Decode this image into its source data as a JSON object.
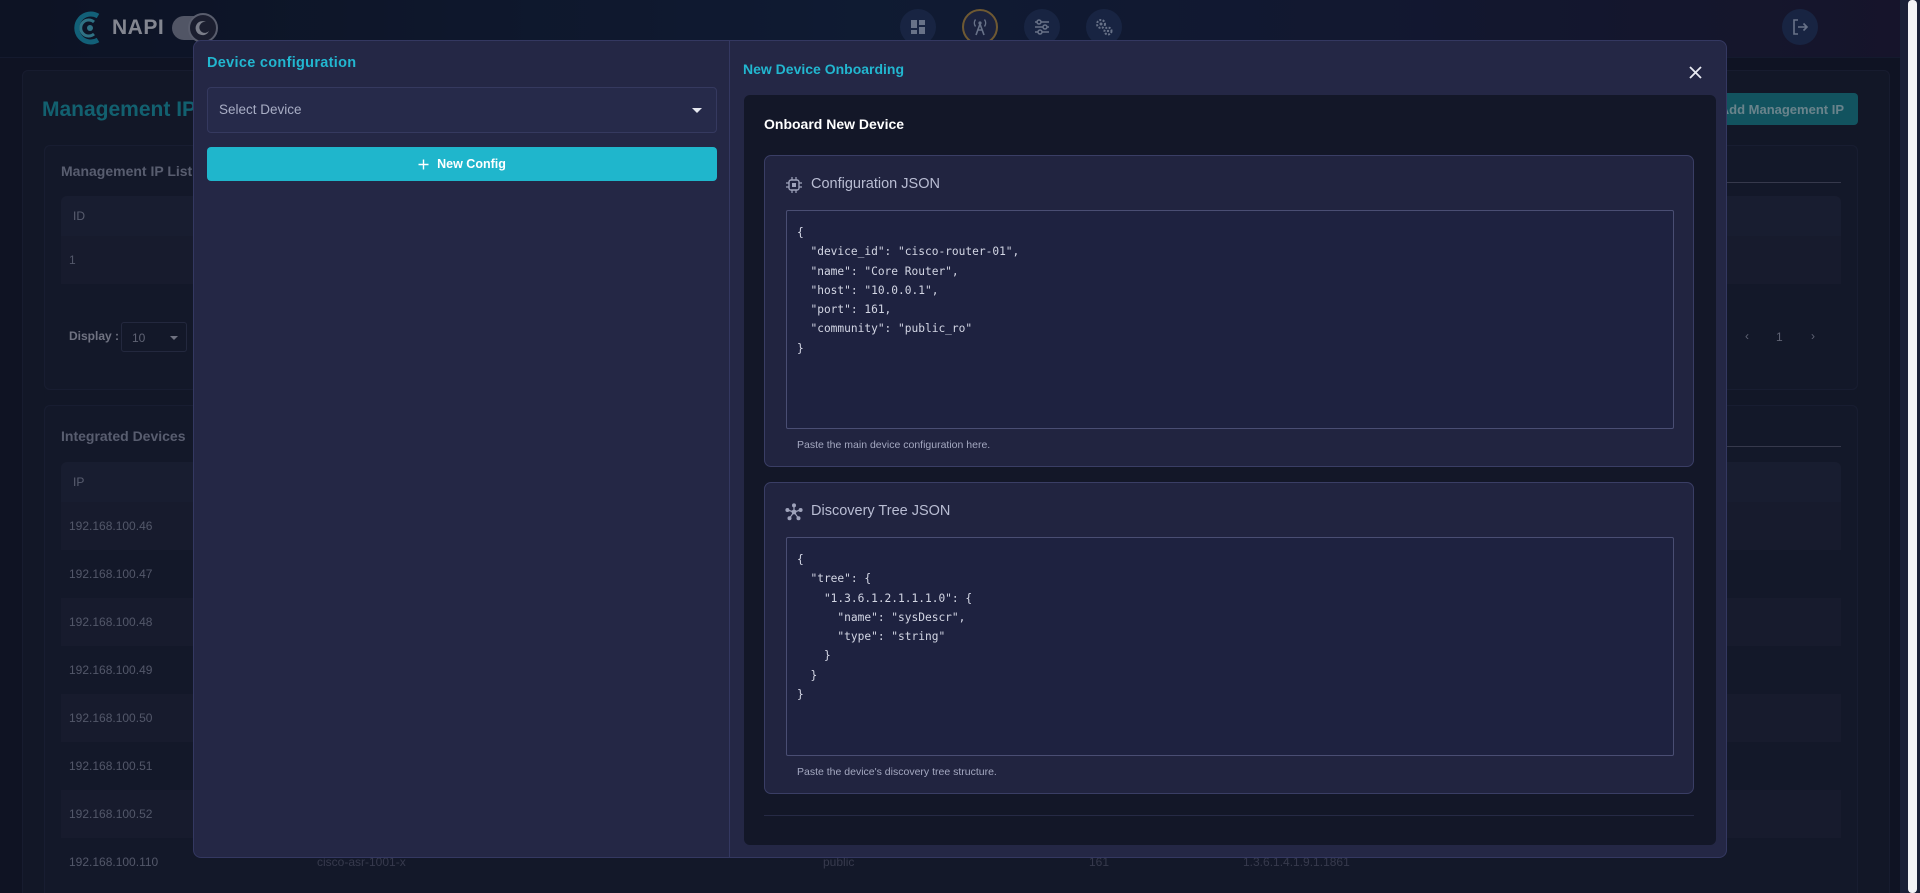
{
  "brand": {
    "name": "NAPI"
  },
  "nav": {
    "icons": [
      "dashboard-icon",
      "broadcast-tower-icon",
      "sliders-icon",
      "cogs-icon"
    ],
    "logout_icon": "logout-icon"
  },
  "background_page": {
    "title": "Management IP",
    "add_button": "Add Management IP",
    "management_list": {
      "title": "Management IP List",
      "columns": [
        "ID"
      ],
      "rows": [
        [
          "1"
        ]
      ],
      "display_label": "Display :",
      "display_value": "10",
      "page": "1"
    },
    "integrated_devices": {
      "title": "Integrated Devices",
      "columns": [
        "IP"
      ],
      "rows": [
        [
          "192.168.100.46"
        ],
        [
          "192.168.100.47"
        ],
        [
          "192.168.100.48"
        ],
        [
          "192.168.100.49"
        ],
        [
          "192.168.100.50"
        ],
        [
          "192.168.100.51"
        ],
        [
          "192.168.100.52"
        ],
        [
          "192.168.100.110",
          "cisco-asr-1001-x",
          "public",
          "161",
          "1.3.6.1.4.1.9.1.1861"
        ]
      ]
    }
  },
  "modal": {
    "left": {
      "title": "Device configuration",
      "select_placeholder": "Select Device",
      "new_config_label": "New Config"
    },
    "right": {
      "title": "New Device Onboarding",
      "panel_heading": "Onboard New Device",
      "config_section": {
        "label": "Configuration JSON",
        "value": "{\n  \"device_id\": \"cisco-router-01\",\n  \"name\": \"Core Router\",\n  \"host\": \"10.0.0.1\",\n  \"port\": 161,\n  \"community\": \"public_ro\"\n}",
        "helper": "Paste the main device configuration here."
      },
      "tree_section": {
        "label": "Discovery Tree JSON",
        "value": "{\n  \"tree\": {\n    \"1.3.6.1.2.1.1.1.0\": {\n      \"name\": \"sysDescr\",\n      \"type\": \"string\"\n    }\n  }\n}",
        "helper": "Paste the device's discovery tree structure."
      }
    }
  },
  "colors": {
    "accent": "#1fb6cc",
    "modal_bg": "#242745",
    "panel_bg": "#131728"
  }
}
